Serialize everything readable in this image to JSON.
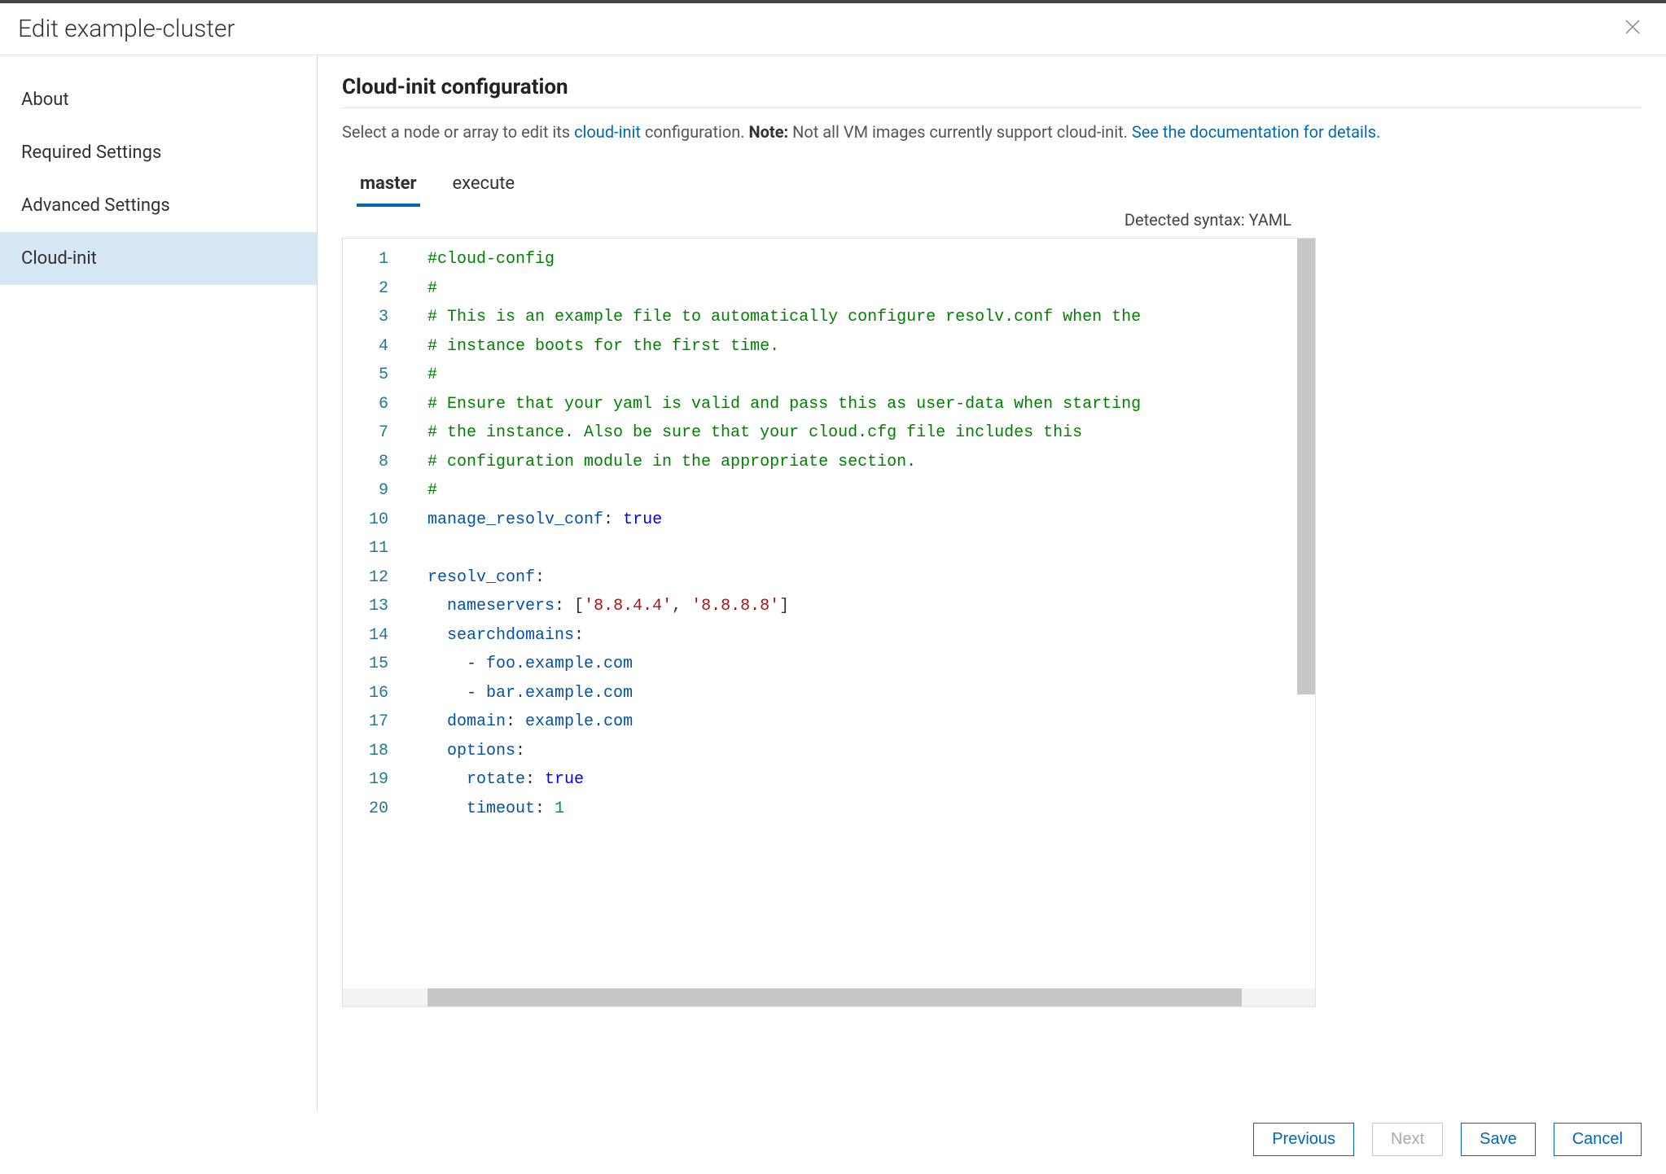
{
  "header": {
    "title": "Edit example-cluster"
  },
  "sidebar": {
    "items": [
      {
        "label": "About",
        "active": false
      },
      {
        "label": "Required Settings",
        "active": false
      },
      {
        "label": "Advanced Settings",
        "active": false
      },
      {
        "label": "Cloud-init",
        "active": true
      }
    ]
  },
  "main": {
    "section_title": "Cloud-init configuration",
    "desc_pre": "Select a node or array to edit its ",
    "desc_link1": "cloud-init",
    "desc_mid": " configuration. ",
    "desc_note_label": "Note:",
    "desc_note_text": " Not all VM images currently support cloud-init. ",
    "desc_link2": "See the documentation for details.",
    "tabs": [
      {
        "label": "master",
        "active": true
      },
      {
        "label": "execute",
        "active": false
      }
    ],
    "syntax_label": "Detected syntax: YAML",
    "editor": {
      "line_numbers": [
        "1",
        "2",
        "3",
        "4",
        "5",
        "6",
        "7",
        "8",
        "9",
        "10",
        "11",
        "12",
        "13",
        "14",
        "15",
        "16",
        "17",
        "18",
        "19",
        "20"
      ],
      "lines": [
        [
          {
            "cls": "tok-comment",
            "t": "#cloud-config"
          }
        ],
        [
          {
            "cls": "tok-comment",
            "t": "#"
          }
        ],
        [
          {
            "cls": "tok-comment",
            "t": "# This is an example file to automatically configure resolv.conf when the"
          }
        ],
        [
          {
            "cls": "tok-comment",
            "t": "# instance boots for the first time."
          }
        ],
        [
          {
            "cls": "tok-comment",
            "t": "#"
          }
        ],
        [
          {
            "cls": "tok-comment",
            "t": "# Ensure that your yaml is valid and pass this as user-data when starting"
          }
        ],
        [
          {
            "cls": "tok-comment",
            "t": "# the instance. Also be sure that your cloud.cfg file includes this"
          }
        ],
        [
          {
            "cls": "tok-comment",
            "t": "# configuration module in the appropriate section."
          }
        ],
        [
          {
            "cls": "tok-comment",
            "t": "#"
          }
        ],
        [
          {
            "cls": "tok-key",
            "t": "manage_resolv_conf"
          },
          {
            "cls": "tok-punc",
            "t": ": "
          },
          {
            "cls": "tok-bool",
            "t": "true"
          }
        ],
        [],
        [
          {
            "cls": "tok-key",
            "t": "resolv_conf"
          },
          {
            "cls": "tok-punc",
            "t": ":"
          }
        ],
        [
          {
            "cls": "tok-punc",
            "t": "  "
          },
          {
            "cls": "tok-key",
            "t": "nameservers"
          },
          {
            "cls": "tok-punc",
            "t": ": ["
          },
          {
            "cls": "tok-str",
            "t": "'8.8.4.4'"
          },
          {
            "cls": "tok-punc",
            "t": ", "
          },
          {
            "cls": "tok-str",
            "t": "'8.8.8.8'"
          },
          {
            "cls": "tok-punc",
            "t": "]"
          }
        ],
        [
          {
            "cls": "tok-punc",
            "t": "  "
          },
          {
            "cls": "tok-key",
            "t": "searchdomains"
          },
          {
            "cls": "tok-punc",
            "t": ":"
          }
        ],
        [
          {
            "cls": "tok-punc",
            "t": "    - "
          },
          {
            "cls": "tok-key",
            "t": "foo.example.com"
          }
        ],
        [
          {
            "cls": "tok-punc",
            "t": "    - "
          },
          {
            "cls": "tok-key",
            "t": "bar.example.com"
          }
        ],
        [
          {
            "cls": "tok-punc",
            "t": "  "
          },
          {
            "cls": "tok-key",
            "t": "domain"
          },
          {
            "cls": "tok-punc",
            "t": ": "
          },
          {
            "cls": "tok-key",
            "t": "example.com"
          }
        ],
        [
          {
            "cls": "tok-punc",
            "t": "  "
          },
          {
            "cls": "tok-key",
            "t": "options"
          },
          {
            "cls": "tok-punc",
            "t": ":"
          }
        ],
        [
          {
            "cls": "tok-punc",
            "t": "    "
          },
          {
            "cls": "tok-key",
            "t": "rotate"
          },
          {
            "cls": "tok-punc",
            "t": ": "
          },
          {
            "cls": "tok-bool",
            "t": "true"
          }
        ],
        [
          {
            "cls": "tok-punc",
            "t": "    "
          },
          {
            "cls": "tok-key",
            "t": "timeout"
          },
          {
            "cls": "tok-punc",
            "t": ": "
          },
          {
            "cls": "tok-num",
            "t": "1"
          }
        ]
      ]
    }
  },
  "footer": {
    "previous": "Previous",
    "next": "Next",
    "save": "Save",
    "cancel": "Cancel"
  }
}
